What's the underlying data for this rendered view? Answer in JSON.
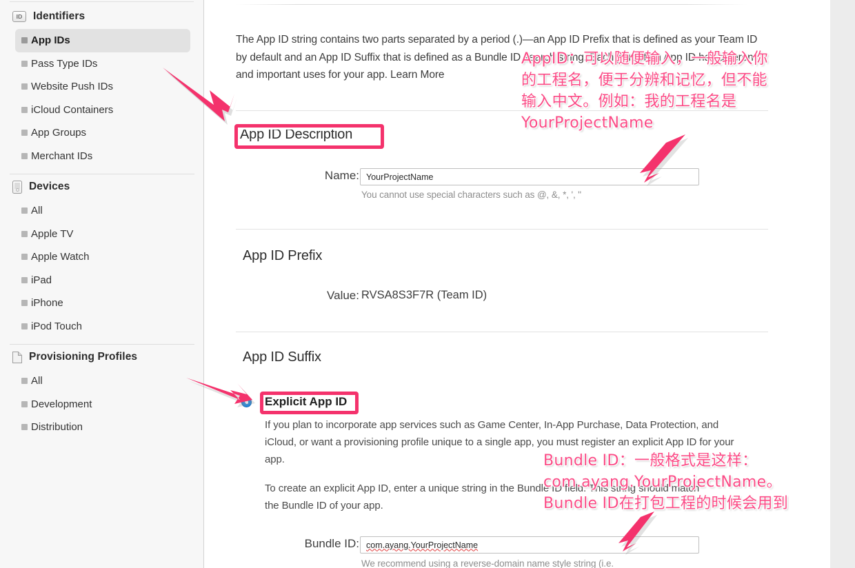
{
  "sidebar": {
    "groups": [
      {
        "title": "Identifiers",
        "icon": "id-badge-icon",
        "icon_label": "ID",
        "items": [
          {
            "label": "App IDs",
            "selected": true
          },
          {
            "label": "Pass Type IDs",
            "selected": false
          },
          {
            "label": "Website Push IDs",
            "selected": false
          },
          {
            "label": "iCloud Containers",
            "selected": false
          },
          {
            "label": "App Groups",
            "selected": false
          },
          {
            "label": "Merchant IDs",
            "selected": false
          }
        ]
      },
      {
        "title": "Devices",
        "icon": "device-icon",
        "items": [
          {
            "label": "All",
            "selected": false
          },
          {
            "label": "Apple TV",
            "selected": false
          },
          {
            "label": "Apple Watch",
            "selected": false
          },
          {
            "label": "iPad",
            "selected": false
          },
          {
            "label": "iPhone",
            "selected": false
          },
          {
            "label": "iPod Touch",
            "selected": false
          }
        ]
      },
      {
        "title": "Provisioning Profiles",
        "icon": "document-icon",
        "items": [
          {
            "label": "All",
            "selected": false
          },
          {
            "label": "Development",
            "selected": false
          },
          {
            "label": "Distribution",
            "selected": false
          }
        ]
      }
    ]
  },
  "main": {
    "intro_paragraph": "The App ID string contains two parts separated by a period (.)—an App ID Prefix that is defined as your Team ID by default and an App ID Suffix that is defined as a Bundle ID search string. Each part of an App ID has different and important uses for your app. Learn More",
    "sections": {
      "description": {
        "title": "App ID Description",
        "name_label": "Name:",
        "name_value": "YourProjectName",
        "name_hint": "You cannot use special characters such as @, &, *, ', \""
      },
      "prefix": {
        "title": "App ID Prefix",
        "value_label": "Value:",
        "value": "RVSA8S3F7R (Team ID)"
      },
      "suffix": {
        "title": "App ID Suffix",
        "explicit_label": "Explicit App ID",
        "explicit_body_1": "If you plan to incorporate app services such as Game Center, In-App Purchase, Data Protection, and iCloud, or want a provisioning profile unique to a single app, you must register an explicit App ID for your app.",
        "explicit_body_2": "To create an explicit App ID, enter a unique string in the Bundle ID field. This string should match the Bundle ID of your app.",
        "bundle_label": "Bundle ID:",
        "bundle_value": "com.ayang.YourProjectName",
        "bundle_hint": "We recommend using a reverse-domain name style string (i.e."
      }
    }
  },
  "annotations": {
    "accent_color": "#f4326c",
    "text_color": "#fb4b86",
    "app_id_note": "AppID：可以随便输入，一般输入你\n的工程名，便于分辨和记忆，但不能\n输入中文。例如：我的工程名是\nYourProjectName",
    "bundle_id_note": "Bundle ID：一般格式是这样：\ncom.ayang.YourProjectName。\nBundle ID在打包工程的时候会用到",
    "arrows": [
      {
        "name": "arrow-to-app-id-description"
      },
      {
        "name": "arrow-to-name-field"
      },
      {
        "name": "arrow-to-explicit-app-id"
      },
      {
        "name": "arrow-to-bundle-id-field"
      }
    ]
  }
}
